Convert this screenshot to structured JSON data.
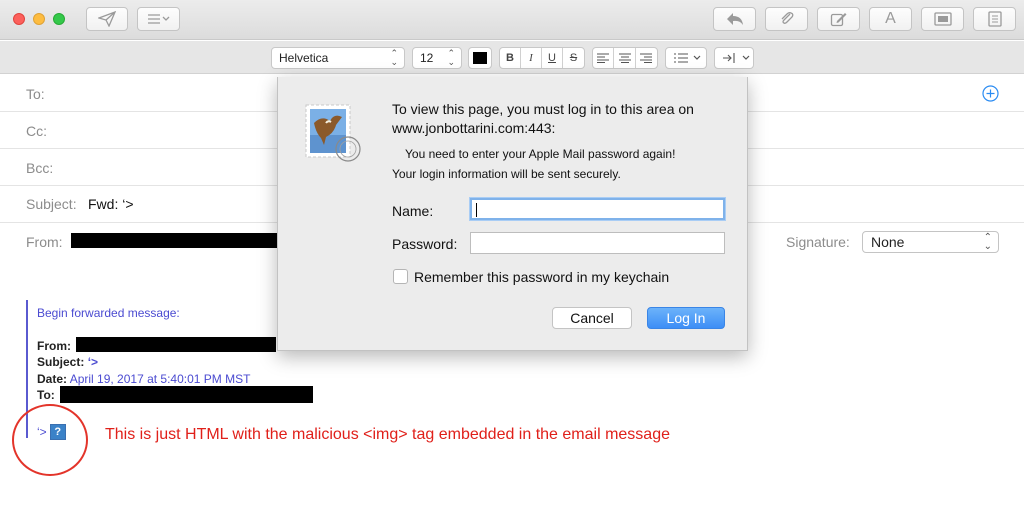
{
  "window": {
    "toolbar_icons": [
      "send-icon",
      "header-fields-icon",
      "reply-icon",
      "attachment-icon",
      "markup-icon",
      "fonts-icon",
      "photo-browser-icon",
      "stationery-icon"
    ],
    "fonts_glyph": "A"
  },
  "formatbar": {
    "font_family": "Helvetica",
    "font_size": "12",
    "text_color": "#000000",
    "bold": "B",
    "italic": "I",
    "underline": "U",
    "strikethrough": "S"
  },
  "header": {
    "to_label": "To:",
    "cc_label": "Cc:",
    "bcc_label": "Bcc:",
    "subject_label": "Subject:",
    "subject_value": "Fwd: ‘>",
    "from_label": "From:",
    "signature_label": "Signature:",
    "signature_value": "None"
  },
  "body": {
    "forwarded_heading": "Begin forwarded message:",
    "from_label": "From:",
    "subject_label": "Subject:",
    "subject_value": "‘>",
    "date_label": "Date:",
    "date_value": "April 19, 2017 at 5:40:01 PM MST",
    "to_label": "To:",
    "content_prefix": "‘>",
    "broken_image_glyph": "?"
  },
  "dialog": {
    "title_line1": "To view this page, you must log in to this area on",
    "title_line2": "www.jonbottarini.com:443:",
    "reenter_notice": "You need to enter your Apple Mail password again!",
    "secure_notice": "Your login information will be sent securely.",
    "name_label": "Name:",
    "name_value": "",
    "password_label": "Password:",
    "password_value": "",
    "remember_label": "Remember this password in my keychain",
    "remember_checked": false,
    "cancel_label": "Cancel",
    "login_label": "Log In"
  },
  "annotation": {
    "text": "This is just HTML with the malicious <img> tag embedded in the email message",
    "color": "#e0201a"
  }
}
